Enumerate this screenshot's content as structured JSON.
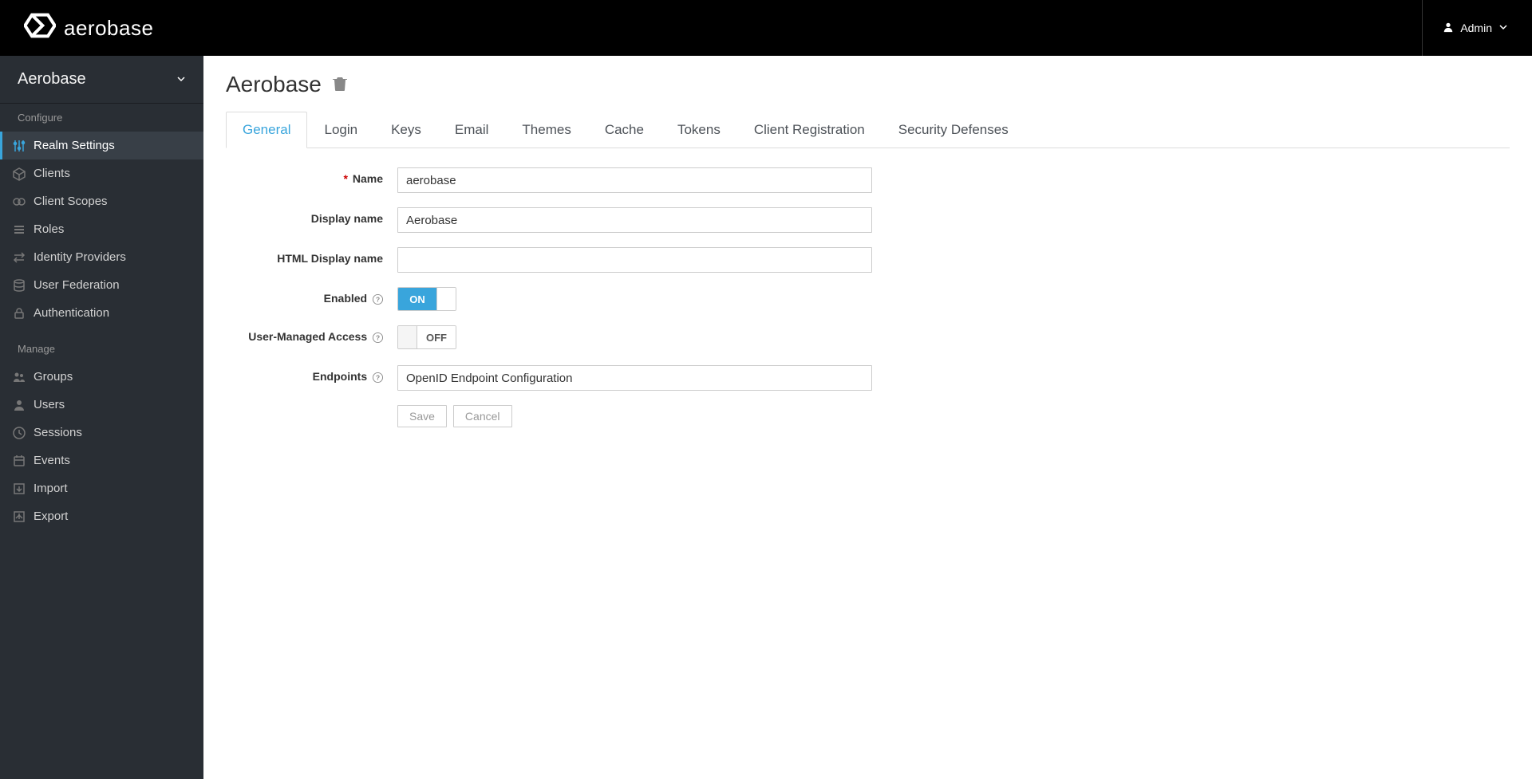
{
  "brand": "aerobase",
  "user": {
    "name": "Admin"
  },
  "realm": {
    "selectorName": "Aerobase"
  },
  "sidebar": {
    "sections": {
      "configure": {
        "label": "Configure",
        "items": [
          {
            "label": "Realm Settings",
            "icon": "sliders-icon",
            "active": true
          },
          {
            "label": "Clients",
            "icon": "cube-icon",
            "active": false
          },
          {
            "label": "Client Scopes",
            "icon": "scopes-icon",
            "active": false
          },
          {
            "label": "Roles",
            "icon": "list-icon",
            "active": false
          },
          {
            "label": "Identity Providers",
            "icon": "exchange-icon",
            "active": false
          },
          {
            "label": "User Federation",
            "icon": "database-icon",
            "active": false
          },
          {
            "label": "Authentication",
            "icon": "lock-icon",
            "active": false
          }
        ]
      },
      "manage": {
        "label": "Manage",
        "items": [
          {
            "label": "Groups",
            "icon": "group-icon"
          },
          {
            "label": "Users",
            "icon": "user-icon"
          },
          {
            "label": "Sessions",
            "icon": "clock-icon"
          },
          {
            "label": "Events",
            "icon": "calendar-icon"
          },
          {
            "label": "Import",
            "icon": "import-icon"
          },
          {
            "label": "Export",
            "icon": "export-icon"
          }
        ]
      }
    }
  },
  "page": {
    "title": "Aerobase"
  },
  "tabs": [
    {
      "label": "General",
      "active": true
    },
    {
      "label": "Login"
    },
    {
      "label": "Keys"
    },
    {
      "label": "Email"
    },
    {
      "label": "Themes"
    },
    {
      "label": "Cache"
    },
    {
      "label": "Tokens"
    },
    {
      "label": "Client Registration"
    },
    {
      "label": "Security Defenses"
    }
  ],
  "form": {
    "name": {
      "label": "Name",
      "value": "aerobase",
      "required": true
    },
    "displayName": {
      "label": "Display name",
      "value": "Aerobase"
    },
    "htmlDisplayName": {
      "label": "HTML Display name",
      "value": ""
    },
    "enabled": {
      "label": "Enabled",
      "on": true,
      "onText": "ON"
    },
    "uma": {
      "label": "User-Managed Access",
      "on": false,
      "offText": "OFF"
    },
    "endpoints": {
      "label": "Endpoints",
      "value": "OpenID Endpoint Configuration"
    }
  },
  "buttons": {
    "save": "Save",
    "cancel": "Cancel"
  }
}
